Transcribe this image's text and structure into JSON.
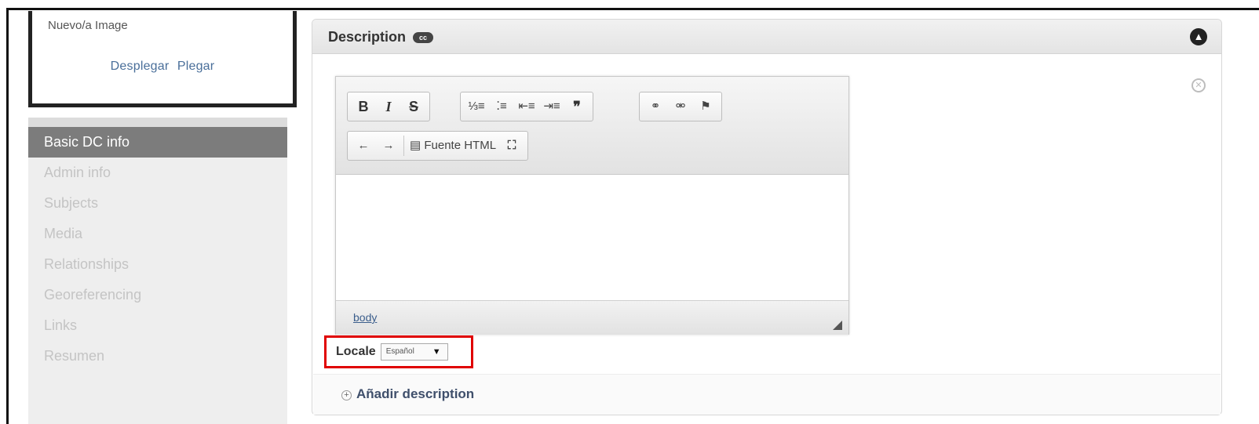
{
  "node_box": {
    "title": "Nuevo/a Image",
    "expand_label": "Desplegar",
    "collapse_label": "Plegar"
  },
  "sidebar": {
    "items": [
      {
        "label": "Basic DC info",
        "active": true
      },
      {
        "label": "Admin info"
      },
      {
        "label": "Subjects"
      },
      {
        "label": "Media"
      },
      {
        "label": "Relationships"
      },
      {
        "label": "Georeferencing"
      },
      {
        "label": "Links"
      },
      {
        "label": "Resumen"
      }
    ]
  },
  "panel": {
    "title": "Description",
    "cc_badge": "cc"
  },
  "editor": {
    "toolbar": {
      "bold": "B",
      "italic": "I",
      "strike": "S",
      "blockquote": "❞",
      "source_label": "Fuente HTML"
    },
    "status_path": "body"
  },
  "locale": {
    "label": "Locale",
    "selected": "Español"
  },
  "add_description": "Añadir description"
}
